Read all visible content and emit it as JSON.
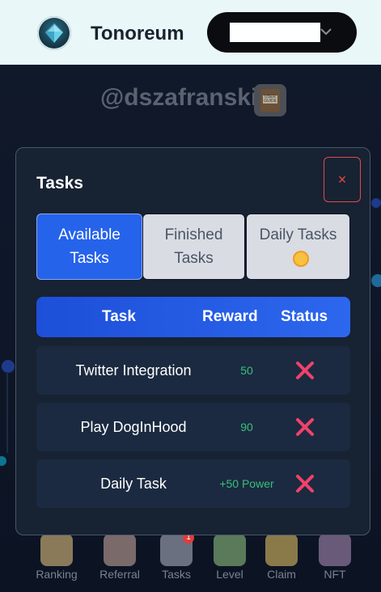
{
  "header": {
    "brand": "Tonoreum"
  },
  "profile": {
    "username": "@dszafranski",
    "guide_icon": "user-guide-book-icon"
  },
  "modal": {
    "title": "Tasks",
    "close_label": "×",
    "tabs": [
      {
        "label": "Available Tasks",
        "active": true
      },
      {
        "label": "Finished Tasks",
        "active": false
      },
      {
        "label": "Daily Tasks",
        "active": false,
        "icon": "sun-icon"
      }
    ],
    "columns": [
      "Task",
      "Reward",
      "Status"
    ],
    "rows": [
      {
        "task": "Twitter Integration",
        "reward": "50",
        "status": "not-completed"
      },
      {
        "task": "Play DogInHood",
        "reward": "90",
        "status": "not-completed"
      },
      {
        "task": "Daily Task",
        "reward": "+50 Power",
        "status": "not-completed"
      }
    ]
  },
  "bottom_nav": [
    {
      "label": "Ranking",
      "icon": "ranking-icon"
    },
    {
      "label": "Referral",
      "icon": "referral-icon"
    },
    {
      "label": "Tasks",
      "icon": "tasks-icon",
      "badge": "1"
    },
    {
      "label": "Level",
      "icon": "level-icon"
    },
    {
      "label": "Claim",
      "icon": "claim-icon"
    },
    {
      "label": "NFT",
      "icon": "nft-icon"
    }
  ],
  "colors": {
    "accent": "#2563eb",
    "reward": "#38c07a",
    "status_fail": "#f0416b",
    "close": "#e24848"
  }
}
